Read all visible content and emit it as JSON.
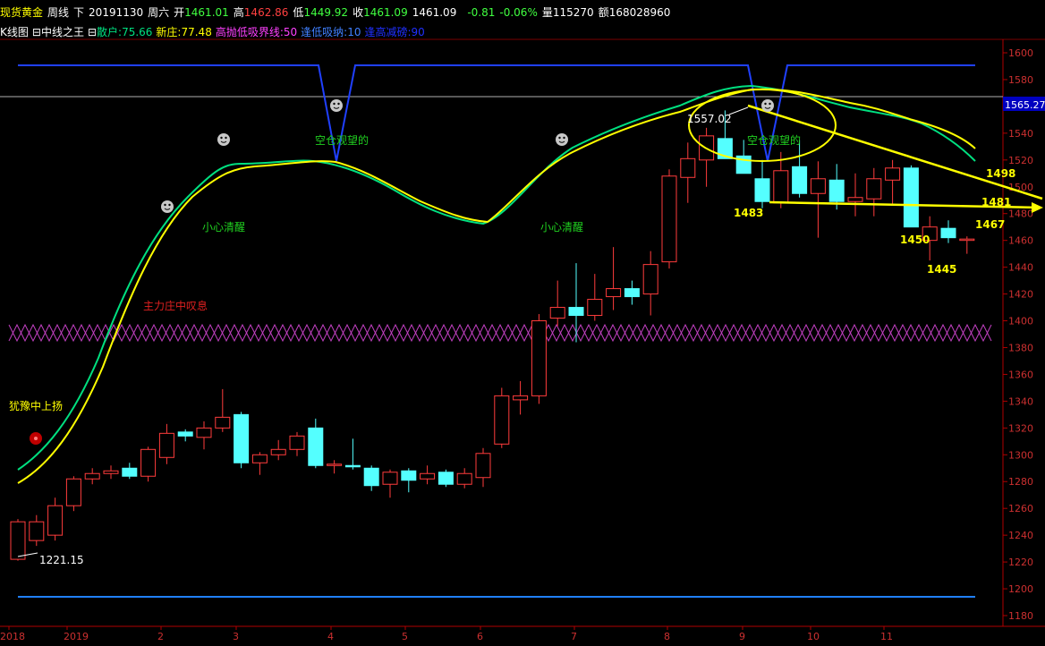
{
  "header": {
    "instrument": "现货黄金",
    "period": "周线",
    "direction": "下",
    "date": "20191130",
    "weekday": "周六",
    "open_label": "开",
    "open": "1461.01",
    "high_label": "高",
    "high": "1462.86",
    "low_label": "低",
    "low": "1449.92",
    "close_label": "收",
    "close": "1461.09",
    "last": "1461.09",
    "change": "-0.81",
    "change_pct": "-0.06%",
    "volume_label": "量",
    "volume": "115270",
    "amount_label": "额",
    "amount": "168028960"
  },
  "indicator": {
    "chart_name": "K线图",
    "name": "中线之王",
    "retail_label": "散户:",
    "retail": "75.66",
    "new_dealer_label": "新庄:",
    "new_dealer": "77.48",
    "high_low_label": "高抛低吸界线:",
    "high_low": "50",
    "buy_low_label": "逢低吸纳:",
    "buy_low": "10",
    "sell_high_label": "逢高减磅:",
    "sell_high": "90"
  },
  "price_axis": {
    "ticks": [
      "1600",
      "1580",
      "1560",
      "1540",
      "1520",
      "1500",
      "1480",
      "1460",
      "1440",
      "1420",
      "1400",
      "1380",
      "1360",
      "1340",
      "1320",
      "1300",
      "1280",
      "1260",
      "1240",
      "1220",
      "1200",
      "1180"
    ],
    "current_price": "1565.27"
  },
  "time_axis": {
    "labels": [
      "2018",
      "2019",
      "2",
      "3",
      "4",
      "5",
      "6",
      "7",
      "8",
      "9",
      "10",
      "11"
    ]
  },
  "annotations": {
    "min_label": "1221.15",
    "max_label": "1557.02",
    "text_hesitate_up": "犹豫中上扬",
    "text_dealer_breath": "主力庄中叹息",
    "text_careful_1": "小心清醒",
    "text_careful_2": "小心清醒",
    "text_empty_1": "空仓观望的",
    "text_empty_2": "空仓观望的",
    "yellow_labels": [
      "1498",
      "1481",
      "1483",
      "1467",
      "1450",
      "1445"
    ]
  },
  "colors": {
    "up": "#ff3c3c",
    "down": "#54ffff",
    "retail_line": "#00e080",
    "dealer_line": "#ffff00",
    "channel_line": "#2040ff",
    "zigzag": "#c040c0",
    "axis_text": "#cc3030",
    "annotation": "#ffff00",
    "signal_text": "#20d020"
  },
  "chart_data": {
    "type": "candlestick",
    "weeks": [
      {
        "o": 1222,
        "h": 1252,
        "l": 1221,
        "c": 1250
      },
      {
        "o": 1236,
        "h": 1255,
        "l": 1232,
        "c": 1250
      },
      {
        "o": 1240,
        "h": 1268,
        "l": 1236,
        "c": 1262
      },
      {
        "o": 1262,
        "h": 1284,
        "l": 1258,
        "c": 1282
      },
      {
        "o": 1282,
        "h": 1290,
        "l": 1278,
        "c": 1286
      },
      {
        "o": 1286,
        "h": 1292,
        "l": 1282,
        "c": 1288
      },
      {
        "o": 1290,
        "h": 1294,
        "l": 1282,
        "c": 1284
      },
      {
        "o": 1284,
        "h": 1306,
        "l": 1280,
        "c": 1304
      },
      {
        "o": 1298,
        "h": 1323,
        "l": 1293,
        "c": 1316
      },
      {
        "o": 1317,
        "h": 1319,
        "l": 1310,
        "c": 1314
      },
      {
        "o": 1313,
        "h": 1325,
        "l": 1304,
        "c": 1320
      },
      {
        "o": 1320,
        "h": 1349,
        "l": 1317,
        "c": 1328
      },
      {
        "o": 1330,
        "h": 1332,
        "l": 1290,
        "c": 1294
      },
      {
        "o": 1294,
        "h": 1302,
        "l": 1285,
        "c": 1300
      },
      {
        "o": 1300,
        "h": 1311,
        "l": 1296,
        "c": 1304
      },
      {
        "o": 1304,
        "h": 1317,
        "l": 1299,
        "c": 1314
      },
      {
        "o": 1320,
        "h": 1327,
        "l": 1290,
        "c": 1292
      },
      {
        "o": 1293,
        "h": 1296,
        "l": 1286,
        "c": 1293
      },
      {
        "o": 1292,
        "h": 1312,
        "l": 1289,
        "c": 1291
      },
      {
        "o": 1290,
        "h": 1292,
        "l": 1273,
        "c": 1277
      },
      {
        "o": 1278,
        "h": 1289,
        "l": 1268,
        "c": 1287
      },
      {
        "o": 1288,
        "h": 1290,
        "l": 1272,
        "c": 1281
      },
      {
        "o": 1282,
        "h": 1292,
        "l": 1278,
        "c": 1286
      },
      {
        "o": 1287,
        "h": 1289,
        "l": 1276,
        "c": 1278
      },
      {
        "o": 1278,
        "h": 1290,
        "l": 1275,
        "c": 1286
      },
      {
        "o": 1283,
        "h": 1305,
        "l": 1276,
        "c": 1301
      },
      {
        "o": 1308,
        "h": 1350,
        "l": 1305,
        "c": 1344
      },
      {
        "o": 1341,
        "h": 1355,
        "l": 1330,
        "c": 1344
      },
      {
        "o": 1344,
        "h": 1405,
        "l": 1338,
        "c": 1400
      },
      {
        "o": 1402,
        "h": 1430,
        "l": 1396,
        "c": 1410
      },
      {
        "o": 1410,
        "h": 1443,
        "l": 1384,
        "c": 1404
      },
      {
        "o": 1404,
        "h": 1435,
        "l": 1400,
        "c": 1416
      },
      {
        "o": 1418,
        "h": 1455,
        "l": 1408,
        "c": 1424
      },
      {
        "o": 1424,
        "h": 1430,
        "l": 1412,
        "c": 1418
      },
      {
        "o": 1420,
        "h": 1452,
        "l": 1404,
        "c": 1442
      },
      {
        "o": 1444,
        "h": 1513,
        "l": 1439,
        "c": 1508
      },
      {
        "o": 1507,
        "h": 1533,
        "l": 1488,
        "c": 1521
      },
      {
        "o": 1520,
        "h": 1544,
        "l": 1500,
        "c": 1538
      },
      {
        "o": 1536,
        "h": 1557,
        "l": 1524,
        "c": 1521
      },
      {
        "o": 1523,
        "h": 1535,
        "l": 1510,
        "c": 1510
      },
      {
        "o": 1506,
        "h": 1520,
        "l": 1484,
        "c": 1489
      },
      {
        "o": 1488,
        "h": 1526,
        "l": 1484,
        "c": 1512
      },
      {
        "o": 1515,
        "h": 1535,
        "l": 1492,
        "c": 1495
      },
      {
        "o": 1495,
        "h": 1519,
        "l": 1462,
        "c": 1506
      },
      {
        "o": 1505,
        "h": 1517,
        "l": 1483,
        "c": 1489
      },
      {
        "o": 1489,
        "h": 1510,
        "l": 1478,
        "c": 1492
      },
      {
        "o": 1491,
        "h": 1514,
        "l": 1478,
        "c": 1506
      },
      {
        "o": 1505,
        "h": 1520,
        "l": 1486,
        "c": 1514
      },
      {
        "o": 1514,
        "h": 1516,
        "l": 1474,
        "c": 1470
      },
      {
        "o": 1460,
        "h": 1478,
        "l": 1445,
        "c": 1470
      },
      {
        "o": 1469,
        "h": 1475,
        "l": 1458,
        "c": 1462
      },
      {
        "o": 1461,
        "h": 1463,
        "l": 1450,
        "c": 1461
      }
    ]
  }
}
